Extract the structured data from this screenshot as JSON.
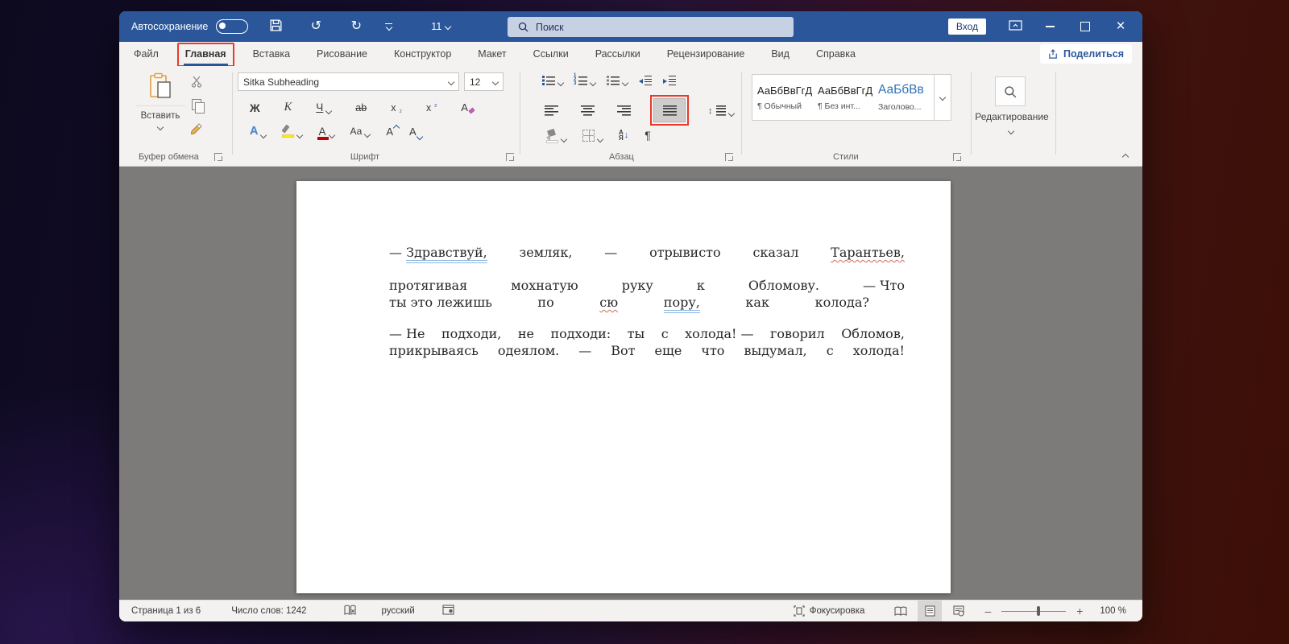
{
  "colors": {
    "titlebar_blue": "#2b579a",
    "annotation_red": "#e8392b",
    "heading_style_blue": "#2e74b5",
    "grammar_underline_blue": "#8ab6df",
    "spelling_underline_red": "#d06a63"
  },
  "title_bar": {
    "autosave_label": "Автосохранение",
    "quick_font_size": "11",
    "search_placeholder": "Поиск",
    "signin_label": "Вход"
  },
  "tabs": {
    "items": [
      {
        "label": "Файл",
        "active": false,
        "annotated": false
      },
      {
        "label": "Главная",
        "active": true,
        "annotated": true
      },
      {
        "label": "Вставка",
        "active": false,
        "annotated": false
      },
      {
        "label": "Рисование",
        "active": false,
        "annotated": false
      },
      {
        "label": "Конструктор",
        "active": false,
        "annotated": false
      },
      {
        "label": "Макет",
        "active": false,
        "annotated": false
      },
      {
        "label": "Ссылки",
        "active": false,
        "annotated": false
      },
      {
        "label": "Рассылки",
        "active": false,
        "annotated": false
      },
      {
        "label": "Рецензирование",
        "active": false,
        "annotated": false
      },
      {
        "label": "Вид",
        "active": false,
        "annotated": false
      },
      {
        "label": "Справка",
        "active": false,
        "annotated": false
      }
    ],
    "share_label": "Поделиться"
  },
  "ribbon": {
    "clipboard": {
      "paste_label": "Вставить",
      "group_label": "Буфер обмена"
    },
    "font": {
      "font_name": "Sitka Subheading",
      "font_size": "12",
      "group_label": "Шрифт",
      "bold": "Ж",
      "italic": "К",
      "underline": "Ч",
      "strikethrough": "ab",
      "script_base": "x",
      "subscript_num": "₂",
      "superscript_num": "²",
      "clear_format": "А",
      "text_effects": "А",
      "font_color_letter": "А",
      "change_case": "Аа",
      "grow_font": "А",
      "shrink_font": "А"
    },
    "paragraph": {
      "group_label": "Абзац",
      "numbering_digits": "1 2 3",
      "sort_top": "А",
      "sort_bottom": "Я",
      "sort_arrow": "↓",
      "spacing_arrow": "↕",
      "pilcrow": "¶"
    },
    "styles": {
      "group_label": "Стили",
      "items": [
        {
          "preview": "АаБбВвГгД",
          "label": "¶ Обычный",
          "heading": false
        },
        {
          "preview": "АаБбВвГгД",
          "label": "¶ Без инт...",
          "heading": false
        },
        {
          "preview": "АаБбВв",
          "label": "Заголово...",
          "heading": true
        }
      ]
    },
    "editing": {
      "label": "Редактирование"
    }
  },
  "document": {
    "lines": [
      {
        "words": [
          {
            "pre": "— ",
            "t": "Здравствуй,",
            "m": "blue"
          },
          {
            "t": "земляк,"
          },
          {
            "t": "—"
          },
          {
            "t": "отрывисто"
          },
          {
            "t": "сказал"
          },
          {
            "t": "Тарантьев,",
            "m": "red"
          }
        ]
      },
      {
        "words": [
          {
            "t": "протягивая"
          },
          {
            "t": "мохнатую"
          },
          {
            "t": "руку"
          },
          {
            "t": "к"
          },
          {
            "t": "Обломову."
          },
          {
            "t": "— Что"
          }
        ]
      },
      {
        "words": [
          {
            "t": "ты это лежишь"
          },
          {
            "t": "по"
          },
          {
            "t": "сю",
            "m": "red"
          },
          {
            "t": "пору,",
            "m": "blue"
          },
          {
            "t": "как"
          },
          {
            "t": "колода?"
          }
        ]
      },
      {
        "words": [
          {
            "t": "— Не"
          },
          {
            "t": "подходи,"
          },
          {
            "t": "не"
          },
          {
            "t": "подходи:"
          },
          {
            "t": "ты"
          },
          {
            "t": "с"
          },
          {
            "t": "холода! —"
          },
          {
            "t": "говорил"
          },
          {
            "t": "Обломов,"
          }
        ]
      },
      {
        "words": [
          {
            "t": "прикрываясь"
          },
          {
            "t": "одеялом."
          },
          {
            "t": "—"
          },
          {
            "t": "Вот"
          },
          {
            "t": "еще"
          },
          {
            "t": "что"
          },
          {
            "t": "выдумал,"
          },
          {
            "t": "с"
          },
          {
            "t": "холода!"
          }
        ]
      }
    ]
  },
  "status_bar": {
    "page_info": "Страница 1 из 6",
    "word_count": "Число слов: 1242",
    "language": "русский",
    "focus_label": "Фокусировка",
    "zoom_out": "–",
    "zoom_in": "+",
    "zoom_level": "100 %"
  }
}
